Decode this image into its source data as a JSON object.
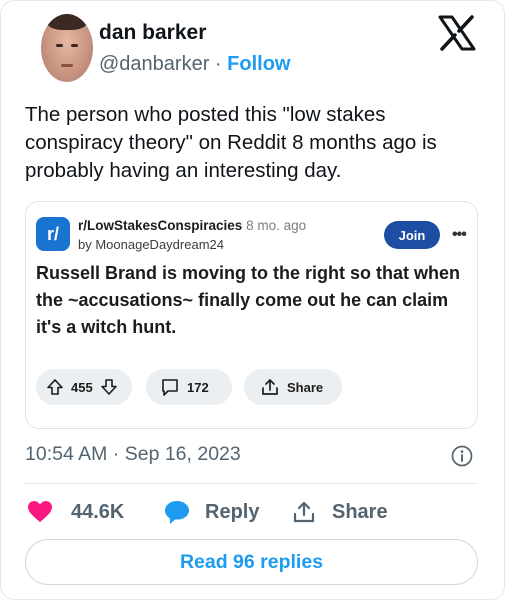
{
  "tweet": {
    "display_name": "dan barker",
    "handle": "@danbarker",
    "separator": " · ",
    "follow_label": "Follow",
    "text": "The person who posted this \"low stakes conspiracy theory\" on Reddit 8 months ago is probably having an interesting day.",
    "timestamp": "10:54 AM · Sep 16, 2023"
  },
  "embed": {
    "subreddit_icon_text": "r/",
    "subreddit": "r/LowStakesConspiracies",
    "time_ago": "8 mo. ago",
    "author": "by MoonageDaydream24",
    "join_label": "Join",
    "more_label": "•••",
    "title": "Russell Brand is moving to the right so that when the ~accusations~ finally come out he can claim it's a witch hunt.",
    "votes": "455",
    "comments": "172",
    "share_label": "Share"
  },
  "actions": {
    "likes": "44.6K",
    "reply_label": "Reply",
    "share_label": "Share",
    "read_replies_label": "Read 96 replies"
  },
  "colors": {
    "like_heart": "#f91880",
    "reply_bubble": "#1d9bf0",
    "link_blue": "#1d9bf0",
    "reddit_join": "#1e4ea3",
    "subreddit_icon": "#1973d1"
  }
}
